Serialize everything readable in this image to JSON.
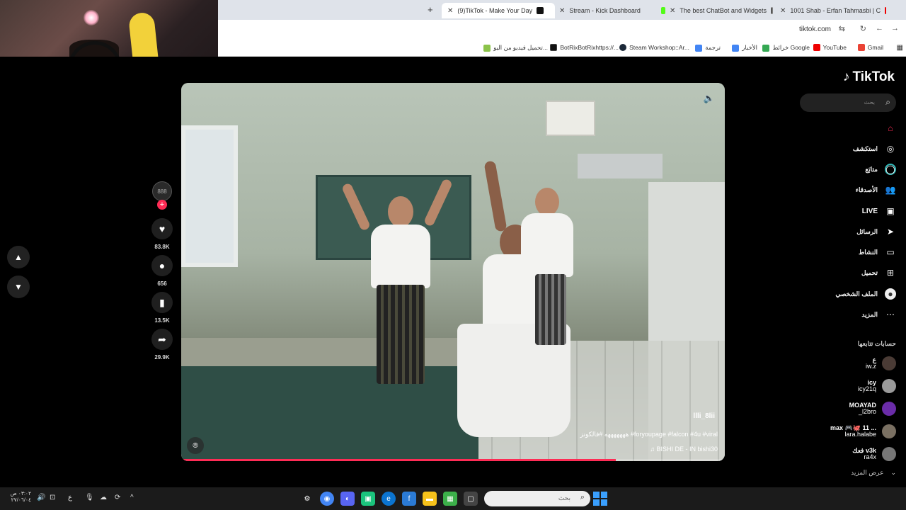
{
  "browser": {
    "tabs": [
      {
        "title": "(9)TikTok - Make Your Day",
        "active": true
      },
      {
        "title": "Stream - Kick Dashboard",
        "active": false
      },
      {
        "title": "The best ChatBot and Widgets",
        "active": false
      },
      {
        "title": "1001 Shab - Erfan Tahmasbi | C",
        "active": false
      }
    ],
    "url": "tiktok.com",
    "bookmarks": [
      {
        "label": "Gmail"
      },
      {
        "label": "YouTube"
      },
      {
        "label": "خرائط Google"
      },
      {
        "label": "الأخبار"
      },
      {
        "label": "ترجمة"
      },
      {
        "label": "Steam Workshop::Ar..."
      },
      {
        "label": "BotRixBotRixhttps://..."
      },
      {
        "label": "تحميل فيديو من اليو..."
      }
    ]
  },
  "sidebar": {
    "logo": "TikTok",
    "search_placeholder": "بحث",
    "nav": [
      {
        "label": "",
        "icon": "home-icon"
      },
      {
        "label": "استكشف",
        "icon": "compass-icon"
      },
      {
        "label": "متابَع",
        "icon": "following-icon"
      },
      {
        "label": "الأصدقاء",
        "icon": "friends-icon"
      },
      {
        "label": "LIVE",
        "icon": "live-icon"
      },
      {
        "label": "الرسائل",
        "icon": "messages-icon"
      },
      {
        "label": "النشاط",
        "icon": "activity-icon"
      },
      {
        "label": "تحميل",
        "icon": "upload-icon"
      },
      {
        "label": "الملف الشخصي",
        "icon": "profile-icon"
      },
      {
        "label": "المزيد",
        "icon": "more-icon"
      }
    ],
    "following_title": "حسابات تتابعها",
    "accounts": [
      {
        "display": "ع",
        "handle": "iw.z"
      },
      {
        "display": "icy",
        "handle": "icy21q"
      },
      {
        "display": "MOAYAD",
        "handle": "_l2bro"
      },
      {
        "display": "max 🎮🐙 11 ...",
        "handle": "lara.halabe"
      },
      {
        "display": "فعك v3k",
        "handle": "ra4x"
      }
    ],
    "see_more": "عرض المزيد"
  },
  "video": {
    "username": "llli_8lii",
    "caption": "هههههههه #فالكونز #foryoupage #falcon #4u #viral",
    "music": "♫ BISHI DE - IN bishi30",
    "progress": 0.8
  },
  "actions": {
    "avatar_text": "888",
    "likes": "83.8K",
    "comments": "656",
    "saves": "13.5K",
    "shares": "29.9K"
  },
  "taskbar": {
    "time": "٠٣:٠٢ ص",
    "date": "٢٧/٠٦/٠٤",
    "search_placeholder": "بحث",
    "lang": "ع"
  },
  "colors": {
    "accent": "#fe2c55",
    "background": "#000000"
  }
}
